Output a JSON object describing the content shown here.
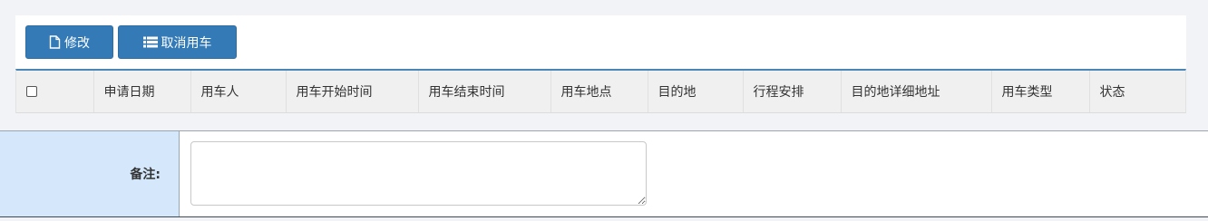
{
  "toolbar": {
    "modify_label": "修改",
    "cancel_label": "取消用车"
  },
  "grid": {
    "columns": [
      "申请日期",
      "用车人",
      "用车开始时间",
      "用车结束时间",
      "用车地点",
      "目的地",
      "行程安排",
      "目的地详细地址",
      "用车类型",
      "状态"
    ]
  },
  "form": {
    "remark_label": "备注:",
    "remark_value": ""
  },
  "colors": {
    "button": "#337ab7",
    "header_border": "#4b86b4",
    "label_bg": "#d4e7fb"
  }
}
